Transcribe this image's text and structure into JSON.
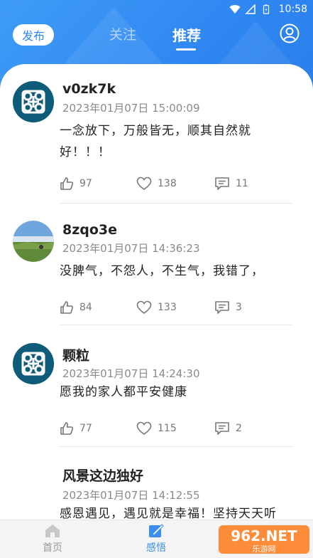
{
  "status_bar": {
    "time": "10:58"
  },
  "nav": {
    "publish_label": "发布",
    "tabs": [
      {
        "label": "关注"
      },
      {
        "label": "推荐"
      }
    ]
  },
  "posts": [
    {
      "username": "v0zk7k",
      "time": "2023年01月07日 15:00:09",
      "text": "一念放下，万般皆无，顺其自然就好！！！",
      "likes": "97",
      "favorites": "138",
      "comments": "11"
    },
    {
      "username": "8zqo3e",
      "time": "2023年01月07日 14:36:23",
      "text": "没脾气，不怨人，不生气，我错了，",
      "likes": "84",
      "favorites": "133",
      "comments": "3"
    },
    {
      "username": "颗粒",
      "time": "2023年01月07日 14:24:30",
      "text": "愿我的家人都平安健康",
      "likes": "77",
      "favorites": "115",
      "comments": "2"
    },
    {
      "username": "风景这边独好",
      "time": "2023年01月07日 14:12:55",
      "text": "感恩遇见，遇见就是幸福！坚持天天听"
    }
  ],
  "bottom_nav": {
    "items": [
      {
        "label": "首页"
      },
      {
        "label": "感悟"
      }
    ]
  },
  "watermark": {
    "brand": "962.NET",
    "sub": "乐游网"
  },
  "colors": {
    "accent": "#2f87f2",
    "active_tab": "#3a8ff0"
  }
}
